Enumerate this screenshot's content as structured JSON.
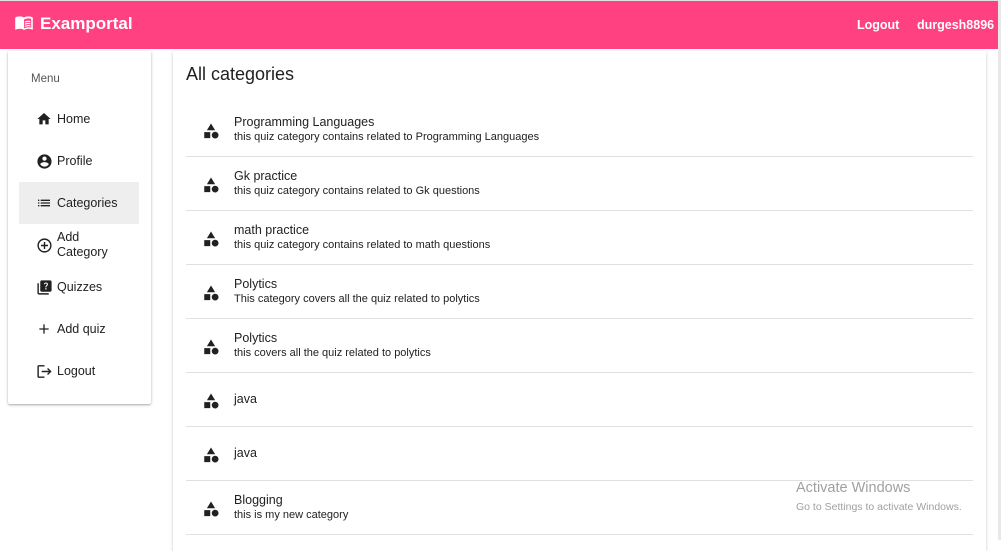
{
  "app": {
    "title": "Examportal",
    "brand_color": "#ff4081",
    "icon": "menu-book-icon"
  },
  "topnav": {
    "logout_label": "Logout",
    "username": "durgesh8896"
  },
  "sidebar": {
    "menu_title": "Menu",
    "items": [
      {
        "label": "Home",
        "icon": "home-icon"
      },
      {
        "label": "Profile",
        "icon": "account-circle-icon"
      },
      {
        "label": "Categories",
        "icon": "list-icon",
        "active": true
      },
      {
        "label": "Add Category",
        "icon": "add-circle-outline-icon"
      },
      {
        "label": "Quizzes",
        "icon": "quiz-icon"
      },
      {
        "label": "Add quiz",
        "icon": "add-icon"
      },
      {
        "label": "Logout",
        "icon": "logout-icon"
      }
    ]
  },
  "main": {
    "title": "All categories",
    "categories": [
      {
        "title": "Programming Languages",
        "description": "this quiz category contains related to Programming Languages"
      },
      {
        "title": "Gk practice",
        "description": "this quiz category contains related to Gk questions"
      },
      {
        "title": "math practice",
        "description": "this quiz category contains related to math questions"
      },
      {
        "title": "Polytics",
        "description": "This category covers all the quiz related to polytics"
      },
      {
        "title": "Polytics",
        "description": "this covers all the quiz related to polytics"
      },
      {
        "title": "java",
        "description": ""
      },
      {
        "title": "java",
        "description": ""
      },
      {
        "title": "Blogging",
        "description": "this is my new category"
      }
    ],
    "category_icon": "category-icon"
  },
  "watermark": {
    "line1": "Activate Windows",
    "line2": "Go to Settings to activate Windows."
  }
}
